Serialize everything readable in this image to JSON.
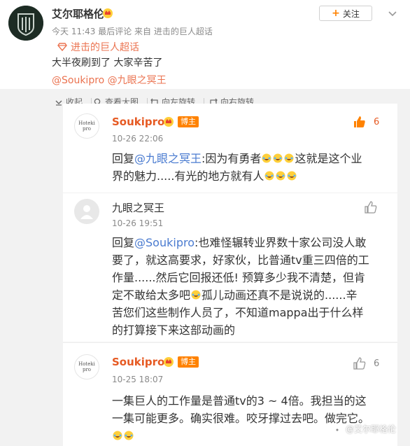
{
  "post": {
    "username": "艾尔耶格伦",
    "meta": "今天 11:43 最后评论 来自 进击的巨人超话",
    "follow_label": "关注",
    "tag": "进击的巨人超话",
    "text": "大半夜刷到了  大家辛苦了",
    "mentions": "@Soukipro @九眼之冥王"
  },
  "toolbar": {
    "collapse": "收起",
    "view_large": "查看大图",
    "rotate_left": "向左旋转",
    "rotate_right": "向右旋转"
  },
  "comments": [
    {
      "name": "Soukipro",
      "badge": "博主",
      "time": "10-26 22:06",
      "likes": "6",
      "avatar_text": "Hoteki pro",
      "reply_prefix": "回复",
      "reply_to": "@九眼之冥王",
      "line1a": ":因为有勇者",
      "line1b": "这就是这个业",
      "line2a": "界的魅力.....有光的地方就有人"
    },
    {
      "name": "九眼之冥王",
      "time": "10-26 19:51",
      "reply_prefix": "回复",
      "reply_to": "@Soukipro",
      "line1": ":也难怪辗转业界数十家公司没人敢",
      "line2": "要了，就这高要求，好家伙，比普通tv重三四倍的工",
      "line3": "作量......然后它回报还低! 预算多少我不清楚，但肯",
      "line4a": "定不敢给太多吧",
      "line4b": "孤儿动画还真不是说说的......辛",
      "line5": "苦您们这些制作人员了，不知道mappa出于什么样",
      "line6": "的打算接下来这部动画的"
    },
    {
      "name": "Soukipro",
      "badge": "博主",
      "time": "10-25 18:07",
      "likes": "6",
      "avatar_text": "Hoteki pro",
      "line1": "一集巨人的工作量是普通tv的3 ~ 4倍。我担当的这",
      "line2": "一集可能更多。确实很难。咬牙撑过去吧。做完它。"
    }
  ],
  "watermark": "@艾尔耶格伦",
  "colors": {
    "accent": "#ff8200",
    "link_orange": "#eb7350",
    "mention_blue": "#4a7bd0",
    "name_orange": "#e65a23"
  }
}
